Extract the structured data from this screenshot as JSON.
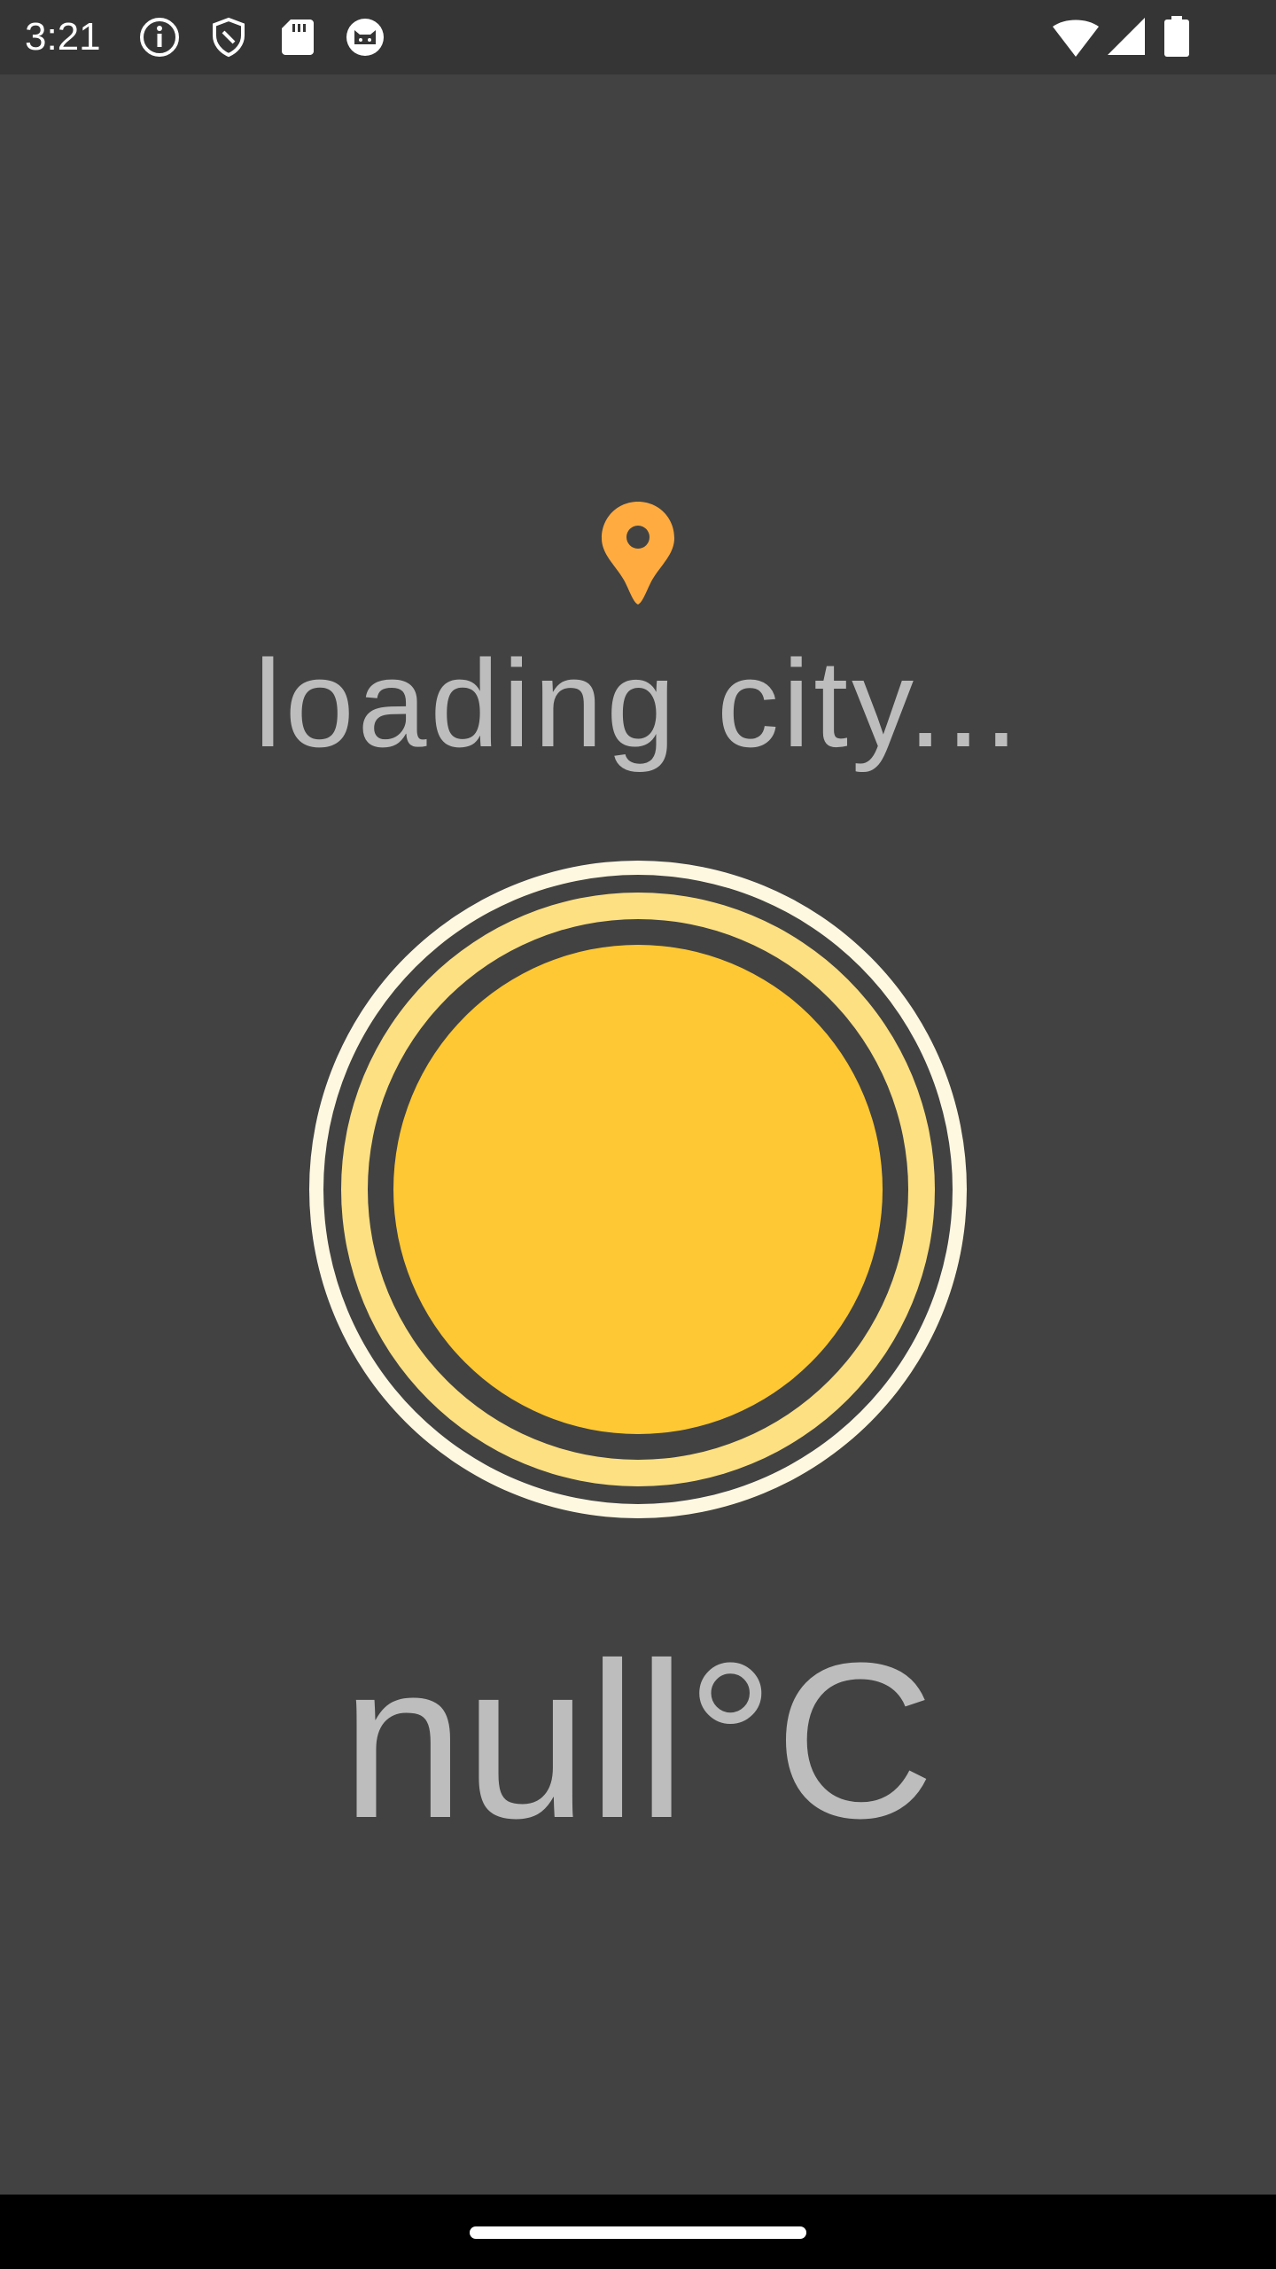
{
  "status_bar": {
    "time": "3:21",
    "left_icons": [
      "info-icon",
      "shield-icon",
      "sd-card-icon",
      "cat-face-icon"
    ],
    "right_icons": [
      "wifi-icon",
      "cellular-signal-icon",
      "battery-icon"
    ]
  },
  "weather": {
    "location_icon": "location-pin-icon",
    "city": "loading city...",
    "condition_icon": "sun-icon",
    "temperature": "null°C"
  },
  "colors": {
    "background": "#424242",
    "status_bar": "#353535",
    "text": "#bdbdbd",
    "pin": "#ffab40",
    "sun_core": "#fdc834",
    "sun_ring_inner": "#fde082",
    "sun_ring_outer": "#fff8e1"
  },
  "nav_bar": {
    "handle": "home-gesture-handle"
  }
}
